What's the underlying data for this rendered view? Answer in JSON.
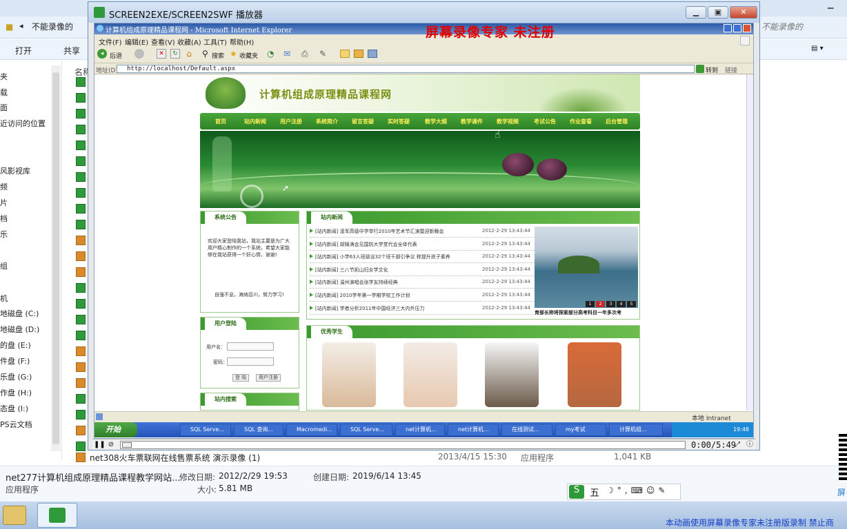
{
  "explorer": {
    "address_crumb": "不能录像的",
    "address_crumb_right": "不能录像的",
    "toolbar": {
      "open": "打开",
      "share": "共享"
    },
    "column_name": "名称",
    "nav_items": [
      "夹",
      "载",
      "面",
      "近访问的位置",
      "风影视库",
      "频",
      "片",
      "档",
      "乐",
      "组",
      "机",
      "地磁盘 (C:)",
      "地磁盘 (D:)",
      "的盘 (E:)",
      "件盘 (F:)",
      "乐盘 (G:)",
      "作盘 (H:)",
      "态盘 (I:)",
      "PS云文档"
    ],
    "file_row": {
      "name": "net308火车票联网在线售票系统 演示录像 (1)",
      "date": "2013/4/15 15:30",
      "type": "应用程序",
      "size": "1,041 KB"
    },
    "details": {
      "name": "net277计算机组成原理精品课程教学网站...",
      "modified_label": "修改日期:",
      "modified": "2012/2/29 19:53",
      "created_label": "创建日期:",
      "created": "2019/6/14 13:45",
      "type": "应用程序",
      "size_label": "大小:",
      "size": "5.81 MB"
    },
    "register_banner": "本动画使用屏幕录像专家未注册版录制  禁止商",
    "ime_label": "五",
    "qr_caption": "屏"
  },
  "player": {
    "title": "SCREEN2EXE/SCREEN2SWF 播放器",
    "watermark": "屏幕录像专家  未注册",
    "time": "0:00/5:49",
    "progress": 0.0
  },
  "ie": {
    "title": "计算机组成原理精品课程网 - Microsoft Internet Explorer",
    "menu": [
      "文件(F)",
      "编辑(E)",
      "查看(V)",
      "收藏(A)",
      "工具(T)",
      "帮助(H)"
    ],
    "toolbar": {
      "back": "后退",
      "search": "搜索",
      "favorites": "收藏夹"
    },
    "address_label": "地址(D)",
    "url": "http://localhost/Default.aspx",
    "go": "转到",
    "links": "链接",
    "status_zone": "本地 Intranet",
    "start": "开始",
    "tasks": [
      "SQL Serve...",
      "SQL 查询...",
      "Macromedi...",
      "SQL Serve...",
      "net计算机...",
      "net计算机...",
      "在线测试...",
      "my考试",
      "计算机组..."
    ],
    "clock": "19:48"
  },
  "site": {
    "title": "计算机组成原理精品课程网",
    "nav": [
      "首页",
      "站内新闻",
      "用户注册",
      "系统简介",
      "留言答疑",
      "实时答疑",
      "教学大纲",
      "教学课件",
      "教学视频",
      "考试公告",
      "作业查看",
      "后台管理"
    ],
    "notice_head": "系统公告",
    "notice_text": "欢迎大家登陆我站，我站主要是为广大用户精心制作的一个系统，希望大家能够在我站获得一个好心情，谢谢!",
    "notice_motto": "自强不息，海纳百川，努力学习!",
    "login_head": "用户登陆",
    "login_user": "用户名：",
    "login_pass": "密码：",
    "login_btn": "登 陆",
    "register_btn": "用户注册",
    "search_head": "站内搜索",
    "news_head": "站内新闻",
    "news": [
      {
        "title": "[站内新闻] 凌军高级中学举行2010年艺术节汇演暨迎新晚会",
        "date": "2012-2-29 13:43:44"
      },
      {
        "title": "[站内新闻] 胡锦涛会见国防大学党代会全体代表",
        "date": "2012-2-29 13:43:44"
      },
      {
        "title": "[站内新闻] 小学63人班级设32个班干部引争议 称提升孩子素养",
        "date": "2012-2-29 13:43:44"
      },
      {
        "title": "[站内新闻] 三八节凯山妇女学文化",
        "date": "2012-2-29 13:43:44"
      },
      {
        "title": "[站内新闻] 温州演唱会张学友持续经典",
        "date": "2012-2-29 13:43:44"
      },
      {
        "title": "[站内新闻] 2010学年第一学期学校工作计划",
        "date": "2012-2-29 13:43:44"
      },
      {
        "title": "[站内新闻] 学者分析2011年中国经济三大内外压力",
        "date": "2012-2-29 13:43:44"
      }
    ],
    "photo_caption": "育部长称将探索部分高考科目一年多次考",
    "photo_pages": [
      "1",
      "2",
      "3",
      "4",
      "5"
    ],
    "students_head": "优秀学生"
  },
  "colors": {
    "site_green": "#3b9a2f",
    "nav_text": "#ffef5a",
    "watermark": "#e00000",
    "banner_text": "#1440c8"
  }
}
